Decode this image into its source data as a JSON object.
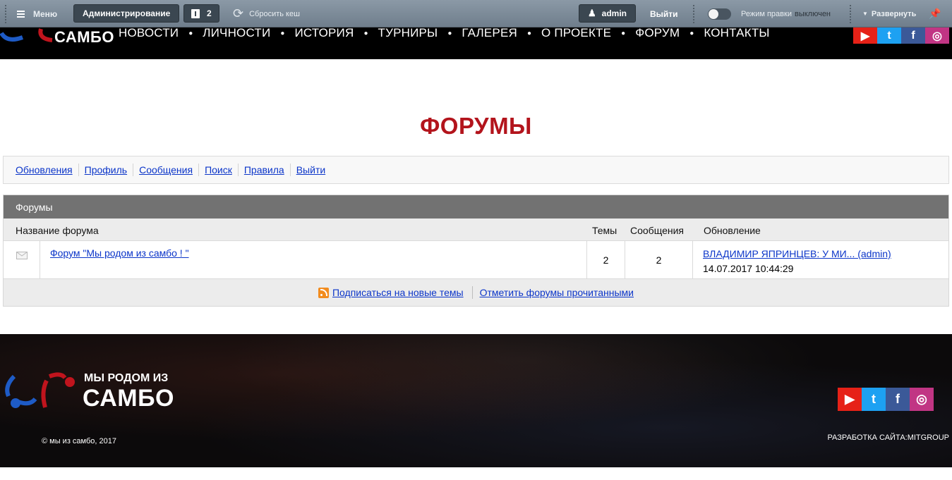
{
  "admin_panel": {
    "menu_label": "Меню",
    "admin_label": "Администрирование",
    "notifications_count": "2",
    "clear_cache_label": "Сбросить кеш",
    "user_label": "admin",
    "logout_label": "Выйти",
    "edit_mode_label": "Режим правки",
    "edit_mode_state": "выключен",
    "expand_label": "Развернуть"
  },
  "header": {
    "logo_text": "САМБО",
    "nav": [
      "НОВОСТИ",
      "ЛИЧНОСТИ",
      "ИСТОРИЯ",
      "ТУРНИРЫ",
      "ГАЛЕРЕЯ",
      "О ПРОЕКТЕ",
      "ФОРУМ",
      "КОНТАКТЫ"
    ],
    "social_icons": [
      "youtube-icon",
      "twitter-icon",
      "facebook-icon",
      "instagram-icon"
    ]
  },
  "page": {
    "title": "ФОРУМЫ",
    "forum_menu": [
      "Обновления",
      "Профиль",
      "Сообщения",
      "Поиск",
      "Правила",
      "Выйти"
    ]
  },
  "forums_table": {
    "header": "Форумы",
    "columns": {
      "name": "Название форума",
      "topics": "Темы",
      "messages": "Сообщения",
      "updated": "Обновление"
    },
    "rows": [
      {
        "name": "Форум \"Мы родом из самбо ! \"",
        "topics": "2",
        "messages": "2",
        "last_post": "ВЛАДИМИР ЯПРИНЦЕВ: У МИ... (admin)",
        "last_date": "14.07.2017 10:44:29"
      }
    ],
    "footer": {
      "subscribe": "Подписаться на новые темы",
      "mark_read": "Отметить форумы прочитанными"
    }
  },
  "footer": {
    "logo_line1": "МЫ РОДОМ ИЗ",
    "logo_line2": "САМБО",
    "copyright": "© мы из самбо, 2017",
    "developer": "РАЗРАБОТКА САЙТА:MITGROUP"
  },
  "colors": {
    "accent_red": "#b3141c",
    "logo_blue": "#1e5bc6",
    "link_blue": "#0b35c9"
  }
}
